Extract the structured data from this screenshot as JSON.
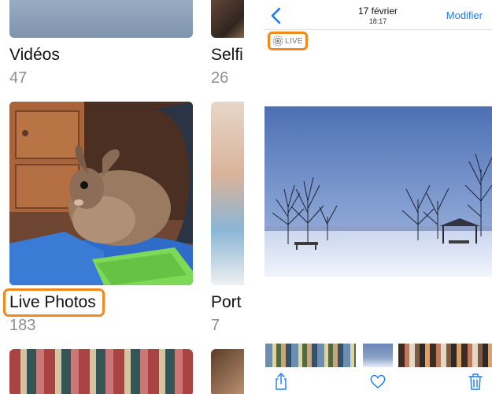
{
  "albums_panel": {
    "albums": [
      {
        "title": "Vidéos",
        "count": "47"
      },
      {
        "title": "Selfi",
        "count": "26"
      },
      {
        "title": "Live Photos",
        "count": "183"
      },
      {
        "title": "Port",
        "count": "7"
      }
    ],
    "highlight_color": "#f08a1c"
  },
  "viewer": {
    "nav": {
      "date": "17 février",
      "time": "18:17",
      "edit_label": "Modifier",
      "back_icon": "chevron-left-icon"
    },
    "live_badge": {
      "label": "LIVE",
      "icon": "live-photo-icon"
    },
    "toolbar": {
      "share_icon": "share-icon",
      "favorite_icon": "heart-icon",
      "delete_icon": "trash-icon"
    },
    "accent_color": "#1a7cf5"
  }
}
